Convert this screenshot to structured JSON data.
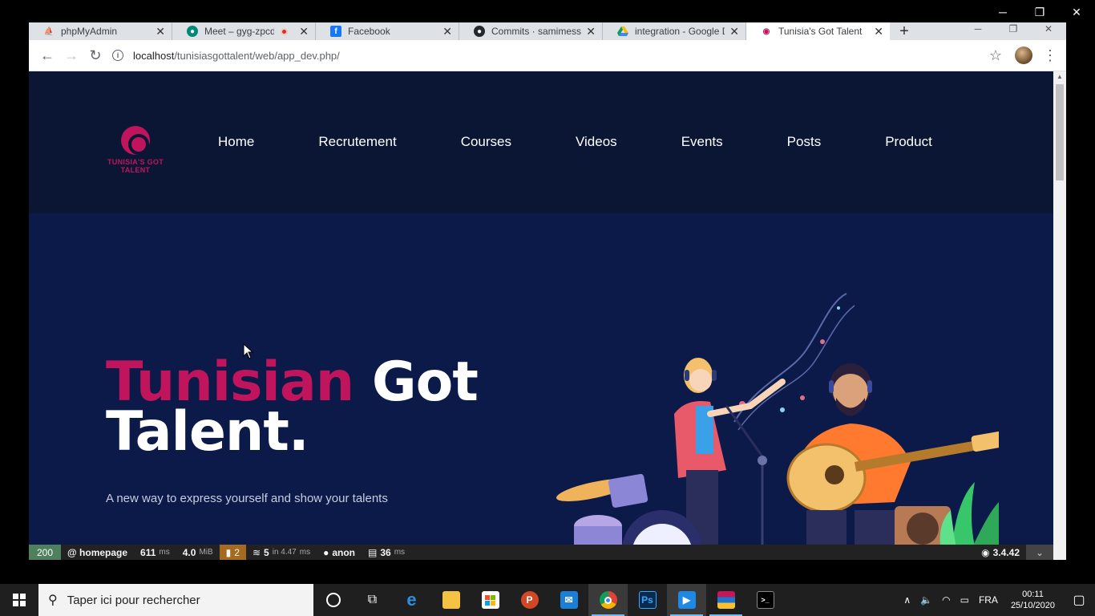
{
  "os_window": {
    "minimize": "─",
    "restore": "❐",
    "close": "✕"
  },
  "browser": {
    "tabs": [
      {
        "title": "phpMyAdmin",
        "icon": "phpmyadmin-icon"
      },
      {
        "title": "Meet – gyg-zpcd-r",
        "icon": "google-meet-icon",
        "recording": true
      },
      {
        "title": "Facebook",
        "icon": "facebook-icon"
      },
      {
        "title": "Commits · samimessao",
        "icon": "github-icon"
      },
      {
        "title": "integration - Google D",
        "icon": "google-drive-icon"
      },
      {
        "title": "Tunisia's Got Talent",
        "icon": "site-icon",
        "active": true
      }
    ],
    "new_tab": "+",
    "close_glyph": "✕",
    "url_host": "localhost",
    "url_path": "/tunisiasgottalent/web/app_dev.php/",
    "back": "←",
    "forward": "→",
    "reload": "↻",
    "star": "☆",
    "menu": "⋮",
    "info": "i"
  },
  "site": {
    "logo_text": "TUNISIA'S GOT TALENT",
    "nav": [
      "Home",
      "Recrutement",
      "Courses",
      "Videos",
      "Events",
      "Posts",
      "Product"
    ],
    "hero_title_accent": "Tunisian",
    "hero_title_rest_1": "Got",
    "hero_title_rest_2": "Talent.",
    "hero_tagline": "A new way to express yourself and show your talents",
    "colors": {
      "accent": "#c0155d",
      "header_bg": "#0b1634",
      "hero_bg": "#0b1a48"
    }
  },
  "debug_toolbar": {
    "status": "200",
    "route": "@ homepage",
    "time": "611",
    "time_unit": "ms",
    "memory": "4.0",
    "memory_unit": "MiB",
    "warnings": "2",
    "db": "5",
    "db_in": "in 4.47",
    "db_unit": "ms",
    "user": "anon",
    "render_time": "36",
    "render_unit": "ms",
    "version": "3.4.42"
  },
  "taskbar": {
    "search_placeholder": "Taper ici pour rechercher",
    "language": "FRA",
    "time": "00:11",
    "date": "25/10/2020"
  }
}
